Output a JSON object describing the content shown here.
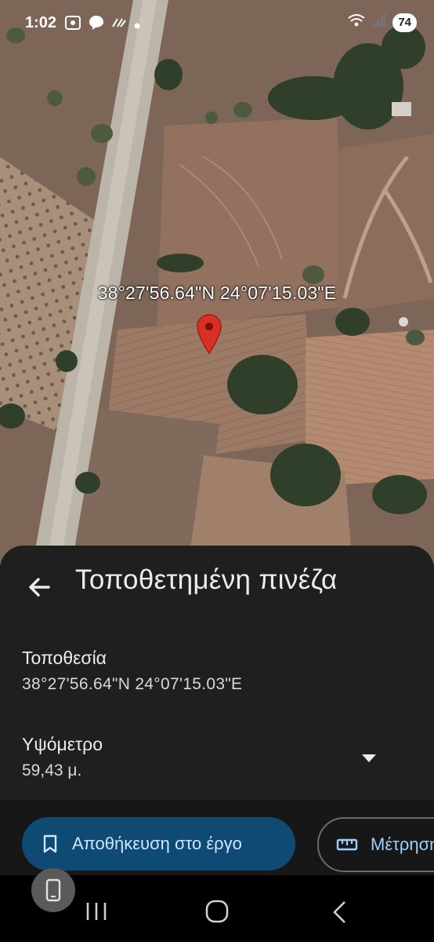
{
  "status_bar": {
    "time": "1:02",
    "battery": "74",
    "icons_left": [
      "screenshot-icon",
      "messenger-icon",
      "sync-icon",
      "dot-icon"
    ],
    "icons_right": [
      "wifi-icon",
      "signal-icon"
    ]
  },
  "map": {
    "coordinates_label": "38°27'56.64\"N 24°07'15.03\"E",
    "pin_color": "#d93025"
  },
  "sheet": {
    "title": "Τοποθετημένη πινέζα",
    "location_label": "Τοποθεσία",
    "location_value": "38°27'56.64\"N 24°07'15.03\"E",
    "altitude_label": "Υψόμετρο",
    "altitude_value": "59,43 μ.",
    "save_button": "Αποθήκευση στο έργο",
    "measure_button": "Μέτρηση"
  },
  "colors": {
    "sheet_bg": "#1f1f1f",
    "save_bg": "#0e4a74",
    "accent": "#9fcfff"
  }
}
